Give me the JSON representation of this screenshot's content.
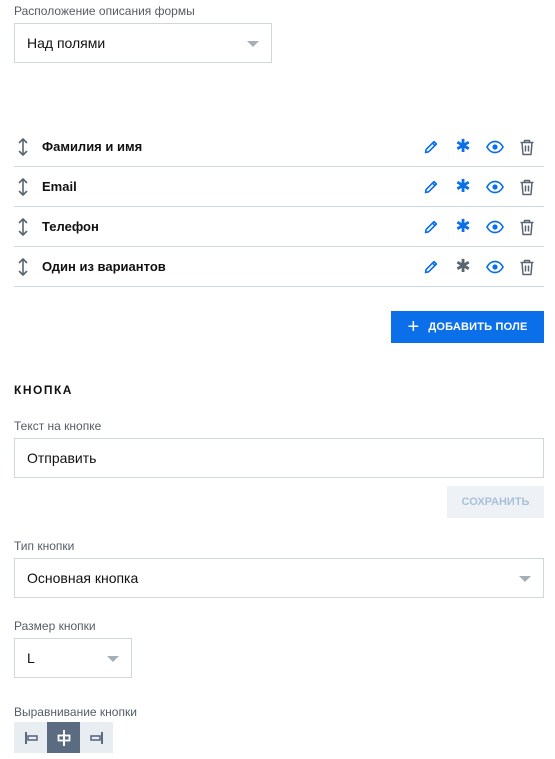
{
  "form_description_position": {
    "label": "Расположение описания формы",
    "value": "Над полями"
  },
  "fields": [
    {
      "name": "Фамилия и имя",
      "required": true
    },
    {
      "name": "Email",
      "required": true
    },
    {
      "name": "Телефон",
      "required": true
    },
    {
      "name": "Один из вариантов",
      "required": false
    }
  ],
  "add_field_button": "ДОБАВИТЬ ПОЛЕ",
  "button_section": {
    "title": "КНОПКА",
    "text_label": "Текст на кнопке",
    "text_value": "Отправить",
    "save_button": "СОХРАНИТЬ",
    "type_label": "Тип кнопки",
    "type_value": "Основная кнопка",
    "size_label": "Размер кнопки",
    "size_value": "L",
    "align_label": "Выравнивание кнопки",
    "align_options": [
      "align-left-icon",
      "align-center-icon",
      "align-right-icon"
    ],
    "align_selected": "center"
  },
  "colors": {
    "accent": "#0a6fe8",
    "icon_blue": "#0a6fe8",
    "icon_gray": "#5b6570",
    "divider": "#c9dbe8"
  }
}
